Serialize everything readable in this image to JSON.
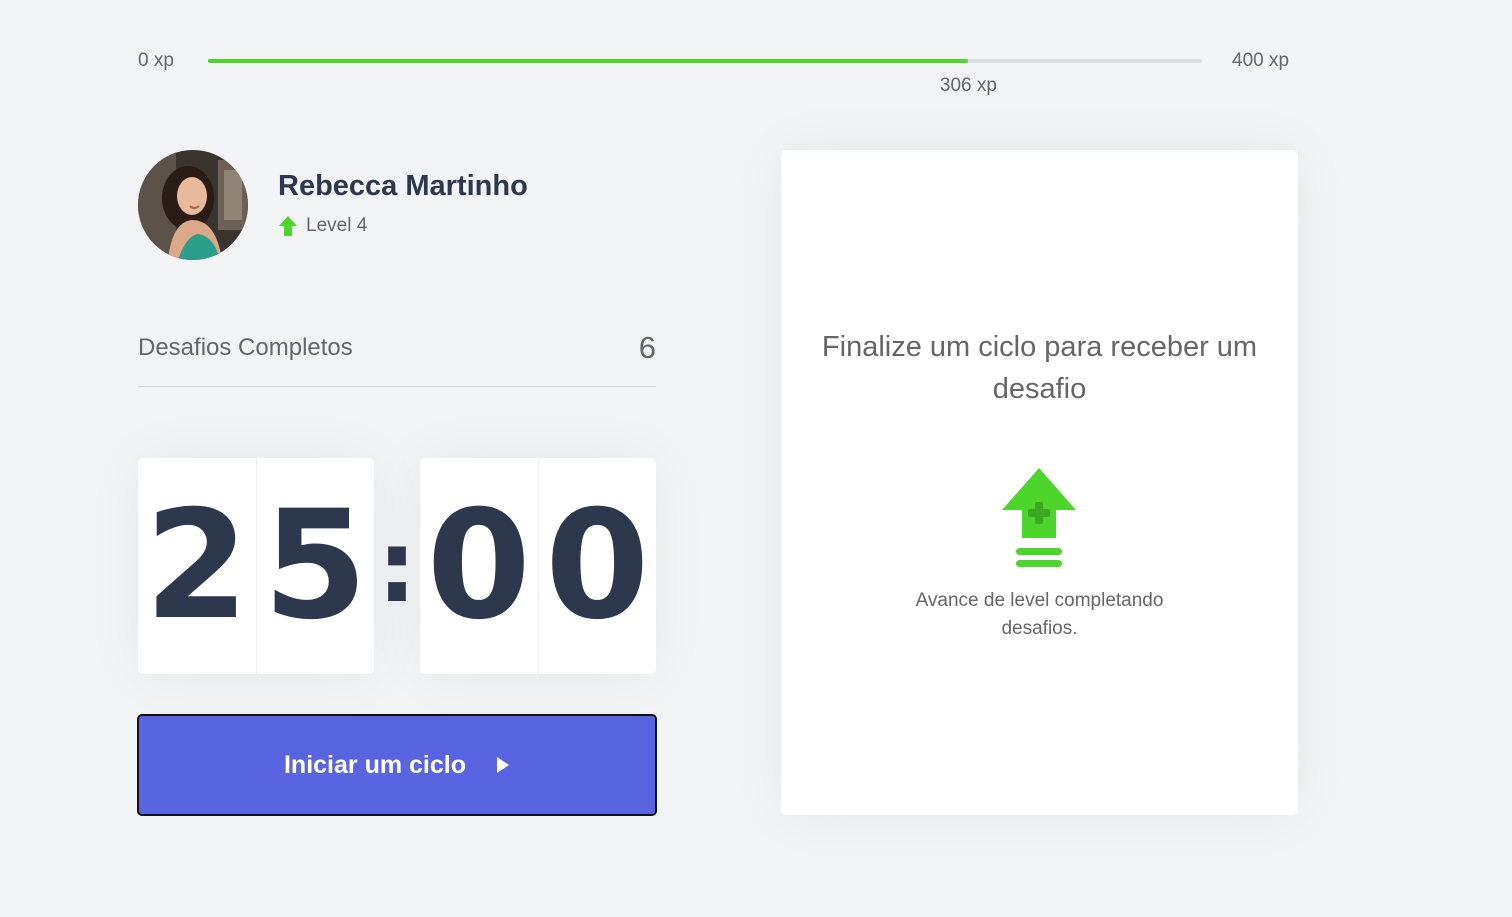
{
  "xp": {
    "min_label": "0 xp",
    "max_label": "400 xp",
    "current_label": "306 xp",
    "current": 306,
    "max": 400
  },
  "profile": {
    "name": "Rebecca Martinho",
    "level_label": "Level 4",
    "avatar_icon": "user-avatar-photo",
    "level_icon": "level-up-arrow-icon"
  },
  "challenges_completed": {
    "label": "Desafios Completos",
    "value": "6"
  },
  "countdown": {
    "minute_left": "2",
    "minute_right": "5",
    "separator": ":",
    "second_left": "0",
    "second_right": "0"
  },
  "start_button": {
    "label": "Iniciar um ciclo",
    "icon": "play-icon"
  },
  "challenge_box": {
    "title": "Finalize um ciclo para receber um desafio",
    "hint": "Avance de level completando desafios.",
    "icon": "level-up-icon"
  },
  "colors": {
    "background": "#f2f3f5",
    "accent_green": "#4cd62b",
    "button_blue": "#5965e0",
    "title_dark": "#2e384d",
    "text": "#666666"
  }
}
